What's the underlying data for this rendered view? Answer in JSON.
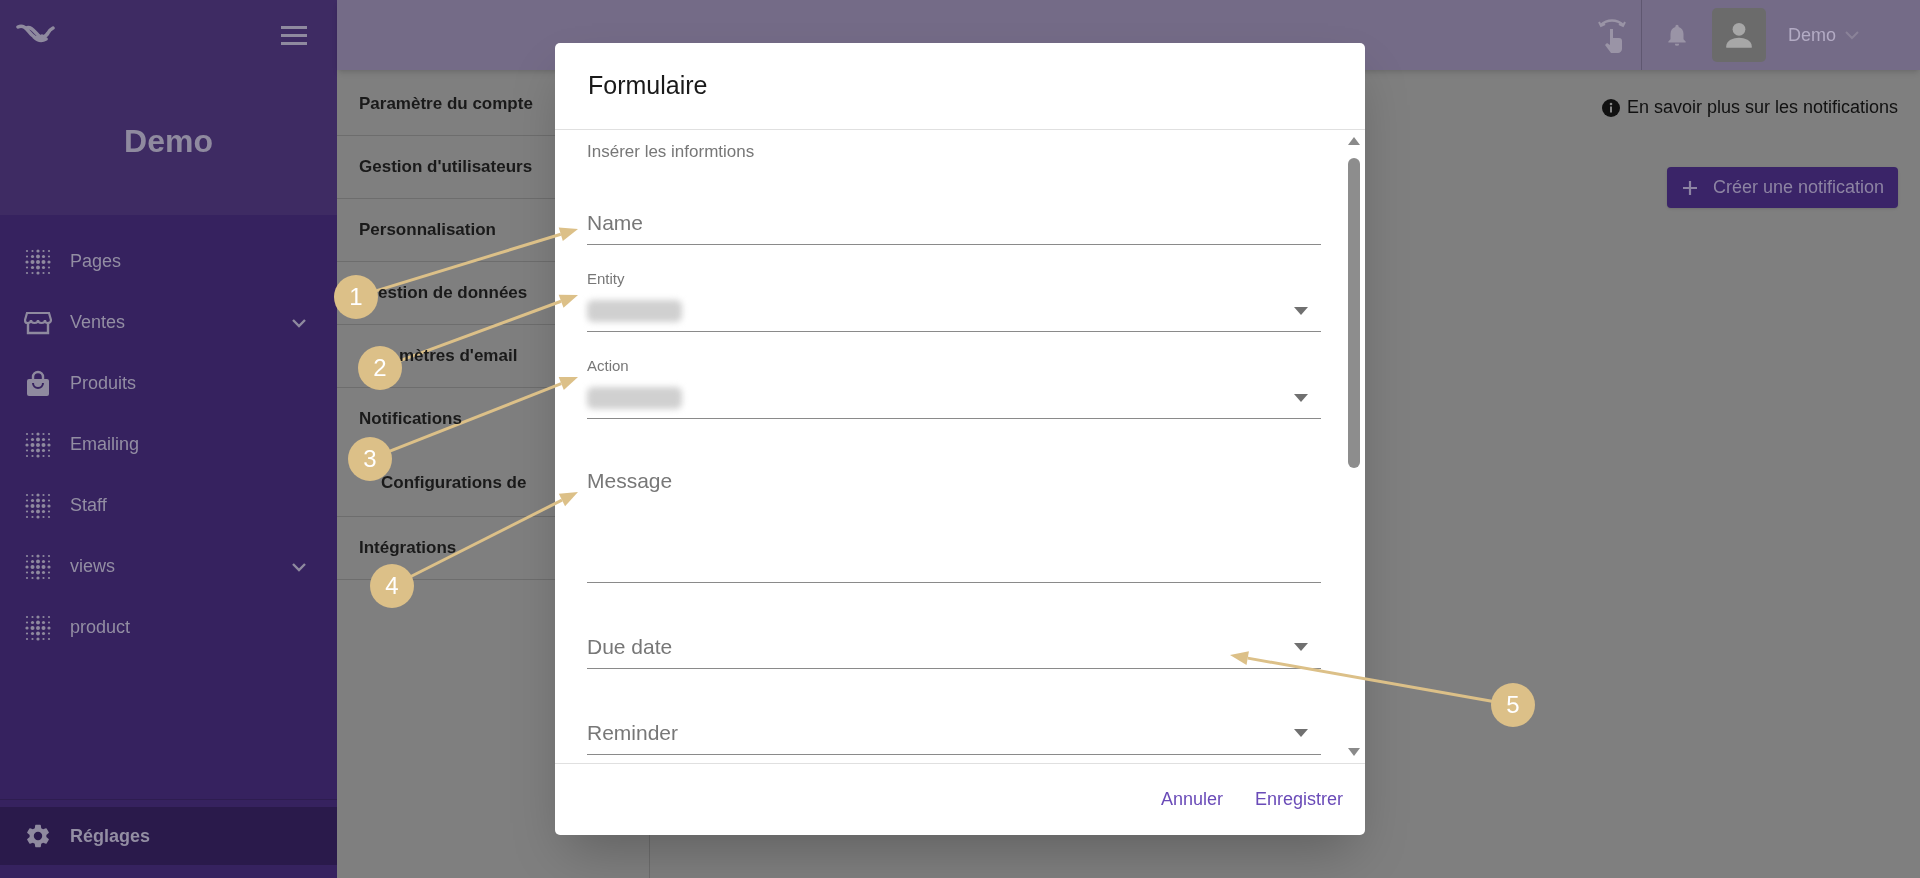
{
  "sidebar": {
    "title": "Demo",
    "items": [
      {
        "label": "Pages",
        "expandable": false
      },
      {
        "label": "Ventes",
        "expandable": true
      },
      {
        "label": "Produits",
        "expandable": false
      },
      {
        "label": "Emailing",
        "expandable": false
      },
      {
        "label": "Staff",
        "expandable": false
      },
      {
        "label": "views",
        "expandable": true
      },
      {
        "label": "product",
        "expandable": false
      }
    ],
    "footer": {
      "label": "Réglages",
      "selected": true
    }
  },
  "topbar": {
    "user": "Demo"
  },
  "settings_menu": [
    {
      "label": "Paramètre du compte",
      "kind": "item"
    },
    {
      "label": "Gestion d'utilisateurs",
      "kind": "item"
    },
    {
      "label": "Personnalisation",
      "kind": "item"
    },
    {
      "label": "estion de données",
      "kind": "item"
    },
    {
      "label": "mètres d'email",
      "kind": "item"
    },
    {
      "label": "Notifications",
      "kind": "group",
      "children": [
        {
          "label": "Configurations de"
        }
      ]
    },
    {
      "label": "Intégrations",
      "kind": "item"
    }
  ],
  "info_link": "En savoir plus sur les notifications",
  "create_button": "Créer une notification",
  "dialog": {
    "title": "Formulaire",
    "subtitle": "Insérer les informtions",
    "fields": [
      {
        "kind": "text",
        "placeholder": "Name"
      },
      {
        "kind": "select",
        "label": "Entity"
      },
      {
        "kind": "select",
        "label": "Action"
      },
      {
        "kind": "textarea",
        "placeholder": "Message"
      },
      {
        "kind": "dropdown",
        "placeholder": "Due date"
      },
      {
        "kind": "dropdown",
        "placeholder": "Reminder"
      }
    ],
    "buttons": [
      "Annuler",
      "Enregistrer"
    ]
  },
  "annotations": [
    {
      "number": "1"
    },
    {
      "number": "2"
    },
    {
      "number": "3"
    },
    {
      "number": "4"
    },
    {
      "number": "5"
    }
  ]
}
